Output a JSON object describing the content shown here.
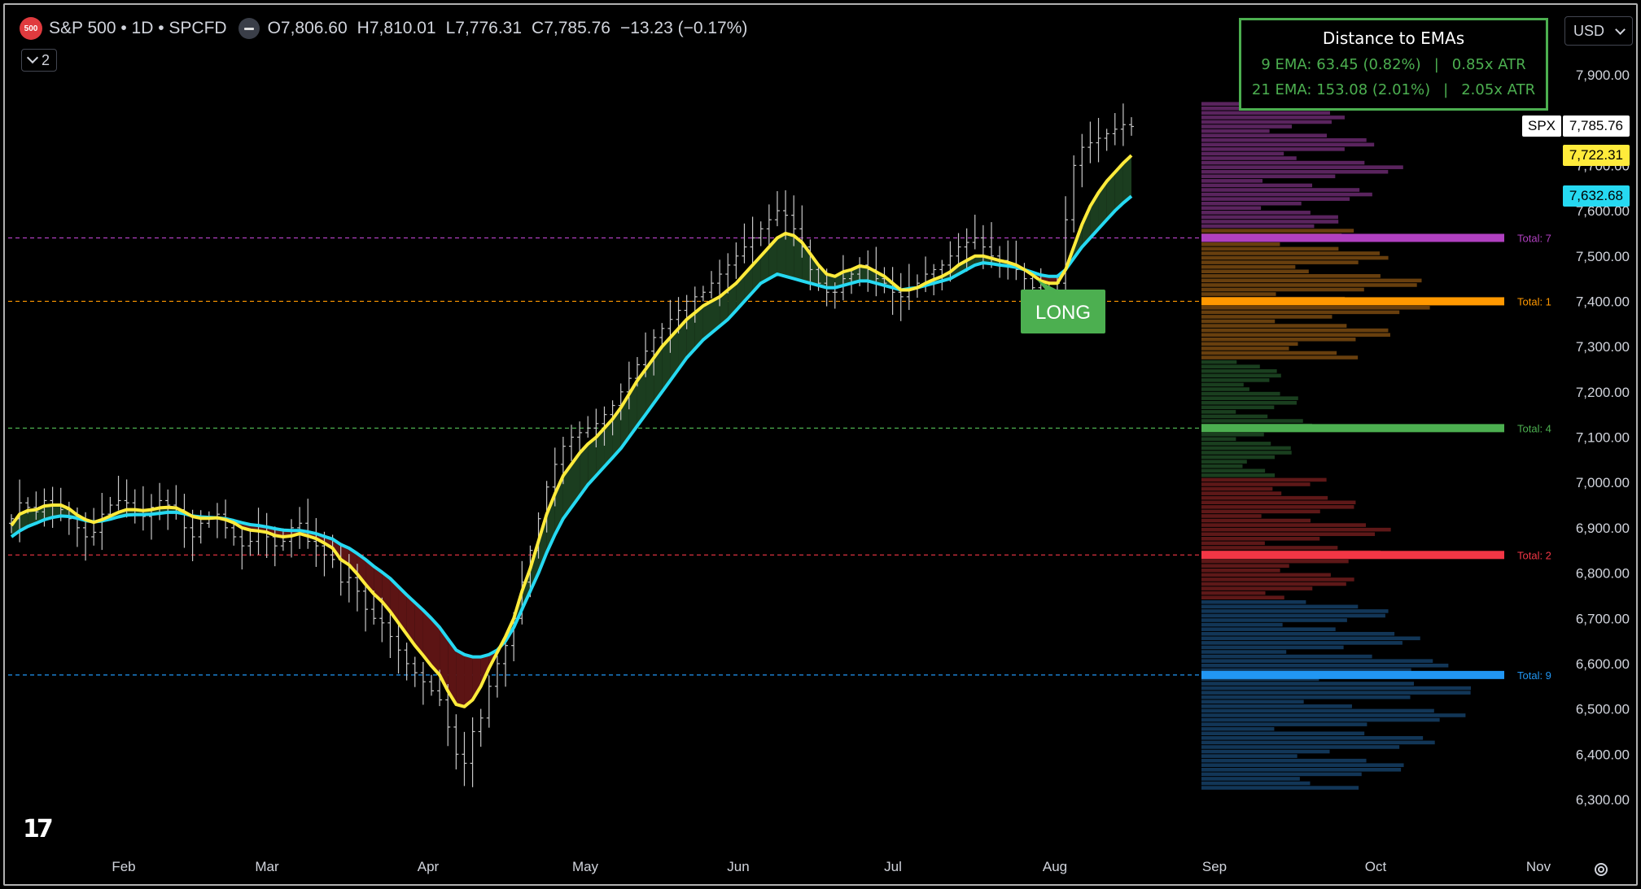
{
  "legend": {
    "badge": "500",
    "title": "S&P 500 • 1D • SPCFD",
    "open_label": "O",
    "open": "7,806.60",
    "high_label": "H",
    "high": "7,810.01",
    "low_label": "L",
    "low": "7,776.31",
    "close_label": "C",
    "close": "7,785.76",
    "change": "−13.23 (−0.17%)",
    "collapsed_count": "2"
  },
  "ema_box": {
    "title": "Distance to EMAs",
    "row9": [
      "9 EMA: 63.45 (0.82%)",
      "|",
      "0.85x ATR"
    ],
    "row21": [
      "21 EMA: 153.08 (2.01%)",
      "|",
      "2.05x ATR"
    ],
    "color": "#4caf50"
  },
  "currency": "USD",
  "price_tags": {
    "last_symbol": "SPX",
    "last_value": "7,785.76",
    "ema9_value": "7,722.31",
    "ema21_value": "7,632.68"
  },
  "signal_label": "LONG",
  "colors": {
    "ema9": "#ffeb3b",
    "ema21": "#26d9f2",
    "bull_fill": "#1b3d1f",
    "bear_fill": "#5c1414",
    "bars": "#c8c8c8"
  },
  "chart_data": {
    "type": "ohlc",
    "title": "S&P 500 • 1D • SPCFD",
    "xlabel": "",
    "ylabel": "",
    "ylim": [
      6300,
      7900
    ],
    "x_ticks": [
      "Feb",
      "Mar",
      "Apr",
      "May",
      "Jun",
      "Jul",
      "Aug",
      "Sep",
      "Oct",
      "Nov"
    ],
    "y_ticks": [
      "6,300.00",
      "6,400.00",
      "6,500.00",
      "6,600.00",
      "6,700.00",
      "6,800.00",
      "6,900.00",
      "7,000.00",
      "7,100.00",
      "7,200.00",
      "7,300.00",
      "7,400.00",
      "7,500.00",
      "7,600.00",
      "7,700.00",
      "7,800.00",
      "7,900.00"
    ],
    "y_tick_values": [
      6300,
      6400,
      6500,
      6600,
      6700,
      6800,
      6900,
      7000,
      7100,
      7200,
      7300,
      7400,
      7500,
      7600,
      7700,
      7800,
      7900
    ],
    "closes": [
      6920,
      6955,
      6945,
      6935,
      6960,
      6950,
      6940,
      6920,
      6900,
      6880,
      6890,
      6930,
      6950,
      6960,
      6955,
      6940,
      6925,
      6945,
      6960,
      6950,
      6940,
      6900,
      6880,
      6910,
      6920,
      6930,
      6900,
      6880,
      6860,
      6870,
      6890,
      6880,
      6860,
      6870,
      6900,
      6910,
      6870,
      6860,
      6840,
      6830,
      6780,
      6790,
      6760,
      6720,
      6700,
      6690,
      6660,
      6630,
      6600,
      6580,
      6560,
      6540,
      6520,
      6460,
      6400,
      6380,
      6450,
      6480,
      6550,
      6600,
      6640,
      6700,
      6780,
      6850,
      6920,
      6990,
      7040,
      7080,
      7100,
      7110,
      7120,
      7130,
      7150,
      7170,
      7200,
      7230,
      7260,
      7290,
      7320,
      7340,
      7360,
      7380,
      7400,
      7410,
      7420,
      7440,
      7460,
      7480,
      7500,
      7520,
      7540,
      7560,
      7580,
      7600,
      7590,
      7560,
      7520,
      7470,
      7440,
      7420,
      7420,
      7450,
      7460,
      7480,
      7470,
      7450,
      7440,
      7420,
      7410,
      7430,
      7440,
      7460,
      7470,
      7480,
      7500,
      7520,
      7530,
      7540,
      7520,
      7500,
      7490,
      7480,
      7470,
      7450,
      7430,
      7410,
      7420,
      7440,
      7580,
      7700,
      7740,
      7750,
      7760,
      7770,
      7780,
      7790,
      7786
    ],
    "ema9": [
      6905,
      6930,
      6938,
      6940,
      6948,
      6950,
      6950,
      6942,
      6928,
      6918,
      6912,
      6918,
      6926,
      6934,
      6940,
      6940,
      6938,
      6940,
      6944,
      6945,
      6944,
      6935,
      6925,
      6921,
      6921,
      6922,
      6918,
      6911,
      6900,
      6895,
      6893,
      6890,
      6883,
      6880,
      6882,
      6887,
      6882,
      6876,
      6866,
      6855,
      6830,
      6818,
      6798,
      6775,
      6754,
      6737,
      6715,
      6690,
      6665,
      6640,
      6618,
      6595,
      6575,
      6540,
      6510,
      6505,
      6520,
      6550,
      6590,
      6625,
      6660,
      6700,
      6760,
      6810,
      6870,
      6930,
      6975,
      7015,
      7040,
      7065,
      7085,
      7100,
      7120,
      7140,
      7165,
      7195,
      7225,
      7250,
      7275,
      7300,
      7320,
      7340,
      7360,
      7375,
      7390,
      7400,
      7410,
      7425,
      7440,
      7460,
      7480,
      7500,
      7520,
      7540,
      7550,
      7545,
      7530,
      7505,
      7480,
      7460,
      7455,
      7465,
      7470,
      7478,
      7475,
      7465,
      7455,
      7440,
      7425,
      7425,
      7430,
      7440,
      7448,
      7455,
      7465,
      7480,
      7490,
      7500,
      7500,
      7495,
      7490,
      7486,
      7480,
      7470,
      7458,
      7445,
      7440,
      7440,
      7470,
      7520,
      7570,
      7610,
      7640,
      7665,
      7685,
      7705,
      7722
    ],
    "ema21": [
      6880,
      6893,
      6903,
      6910,
      6918,
      6923,
      6926,
      6925,
      6921,
      6916,
      6913,
      6915,
      6919,
      6924,
      6928,
      6929,
      6929,
      6930,
      6932,
      6934,
      6934,
      6931,
      6926,
      6924,
      6923,
      6922,
      6920,
      6916,
      6911,
      6907,
      6905,
      6902,
      6898,
      6895,
      6894,
      6894,
      6891,
      6887,
      6881,
      6875,
      6863,
      6855,
      6843,
      6830,
      6815,
      6802,
      6788,
      6770,
      6752,
      6735,
      6718,
      6700,
      6680,
      6655,
      6630,
      6620,
      6615,
      6615,
      6620,
      6630,
      6650,
      6680,
      6720,
      6760,
      6800,
      6845,
      6885,
      6920,
      6945,
      6970,
      6995,
      7015,
      7035,
      7055,
      7075,
      7100,
      7125,
      7150,
      7175,
      7200,
      7225,
      7250,
      7275,
      7295,
      7315,
      7330,
      7345,
      7360,
      7380,
      7400,
      7420,
      7440,
      7450,
      7460,
      7455,
      7450,
      7445,
      7440,
      7435,
      7430,
      7430,
      7435,
      7440,
      7445,
      7445,
      7440,
      7435,
      7430,
      7425,
      7428,
      7430,
      7435,
      7440,
      7445,
      7450,
      7460,
      7470,
      7480,
      7485,
      7483,
      7480,
      7478,
      7475,
      7470,
      7464,
      7458,
      7455,
      7455,
      7470,
      7495,
      7520,
      7540,
      7560,
      7580,
      7600,
      7617,
      7632
    ],
    "volume_profile_markers": [
      {
        "label": "Total: 7",
        "price": 7540,
        "color": "#b040c0"
      },
      {
        "label": "Total: 1",
        "price": 7400,
        "color": "#ff9800"
      },
      {
        "label": "Total: 4",
        "price": 7120,
        "color": "#4caf50"
      },
      {
        "label": "Total: 2",
        "price": 6840,
        "color": "#f23645"
      },
      {
        "label": "Total: 9",
        "price": 6575,
        "color": "#2196f3"
      }
    ]
  }
}
